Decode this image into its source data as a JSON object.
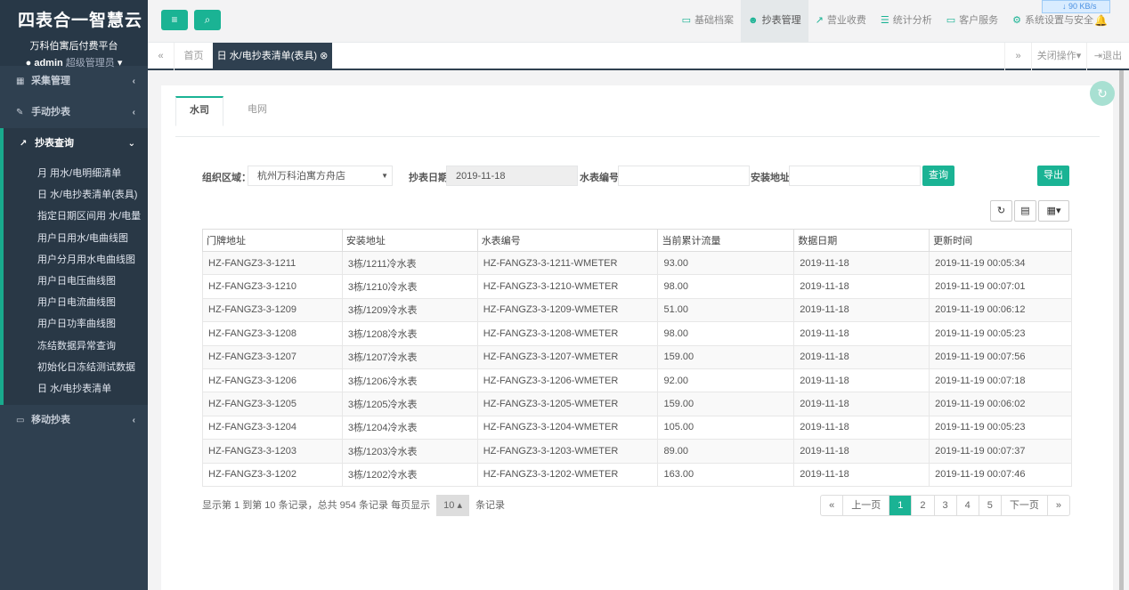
{
  "brand": {
    "title": "四表合一智慧云",
    "subtitle": "万科伯寓后付费平台",
    "user": "admin",
    "role": "超级管理员"
  },
  "sidebar": {
    "items": [
      {
        "label": "采集管理",
        "icon": "calendar-icon"
      },
      {
        "label": "手动抄表",
        "icon": "edit-icon"
      },
      {
        "label": "抄表查询",
        "icon": "chart-icon"
      }
    ],
    "sub": [
      "月 用水/电明细清单",
      "日 水/电抄表清单(表具)",
      "指定日期区间用 水/电量",
      "用户日用水/电曲线图",
      "用户分月用水电曲线图",
      "用户日电压曲线图",
      "用户日电流曲线图",
      "用户日功率曲线图",
      "冻结数据异常查询",
      "初始化日冻结测试数据",
      "日 水/电抄表清单"
    ],
    "last": {
      "label": "移动抄表",
      "icon": "laptop-icon"
    }
  },
  "topnav": [
    "基础档案",
    "抄表管理",
    "营业收费",
    "统计分析",
    "客户服务",
    "系统设置与安全"
  ],
  "speed": "↓ 90 KB/s",
  "tabs": {
    "home": "首页",
    "active": "日 水/电抄表清单(表具)",
    "close_ops": "关闭操作",
    "logout": "退出"
  },
  "content_tabs": [
    "水司",
    "电网"
  ],
  "form": {
    "org_label": "组织区域：",
    "org_value": "杭州万科泊寓方舟店",
    "date_label": "抄表日期",
    "date_value": "2019-11-18",
    "meter_label": "水表编号",
    "addr_label": "安装地址",
    "query": "查询",
    "export": "导出"
  },
  "table": {
    "headers": [
      "门牌地址",
      "安装地址",
      "水表编号",
      "当前累计流量",
      "数据日期",
      "更新时间"
    ],
    "rows": [
      [
        "HZ-FANGZ3-3-1211",
        "3栋/1211冷水表",
        "HZ-FANGZ3-3-1211-WMETER",
        "93.00",
        "2019-11-18",
        "2019-11-19 00:05:34"
      ],
      [
        "HZ-FANGZ3-3-1210",
        "3栋/1210冷水表",
        "HZ-FANGZ3-3-1210-WMETER",
        "98.00",
        "2019-11-18",
        "2019-11-19 00:07:01"
      ],
      [
        "HZ-FANGZ3-3-1209",
        "3栋/1209冷水表",
        "HZ-FANGZ3-3-1209-WMETER",
        "51.00",
        "2019-11-18",
        "2019-11-19 00:06:12"
      ],
      [
        "HZ-FANGZ3-3-1208",
        "3栋/1208冷水表",
        "HZ-FANGZ3-3-1208-WMETER",
        "98.00",
        "2019-11-18",
        "2019-11-19 00:05:23"
      ],
      [
        "HZ-FANGZ3-3-1207",
        "3栋/1207冷水表",
        "HZ-FANGZ3-3-1207-WMETER",
        "159.00",
        "2019-11-18",
        "2019-11-19 00:07:56"
      ],
      [
        "HZ-FANGZ3-3-1206",
        "3栋/1206冷水表",
        "HZ-FANGZ3-3-1206-WMETER",
        "92.00",
        "2019-11-18",
        "2019-11-19 00:07:18"
      ],
      [
        "HZ-FANGZ3-3-1205",
        "3栋/1205冷水表",
        "HZ-FANGZ3-3-1205-WMETER",
        "159.00",
        "2019-11-18",
        "2019-11-19 00:06:02"
      ],
      [
        "HZ-FANGZ3-3-1204",
        "3栋/1204冷水表",
        "HZ-FANGZ3-3-1204-WMETER",
        "105.00",
        "2019-11-18",
        "2019-11-19 00:05:23"
      ],
      [
        "HZ-FANGZ3-3-1203",
        "3栋/1203冷水表",
        "HZ-FANGZ3-3-1203-WMETER",
        "89.00",
        "2019-11-18",
        "2019-11-19 00:07:37"
      ],
      [
        "HZ-FANGZ3-3-1202",
        "3栋/1202冷水表",
        "HZ-FANGZ3-3-1202-WMETER",
        "163.00",
        "2019-11-18",
        "2019-11-19 00:07:46"
      ]
    ]
  },
  "pagination": {
    "info_pre": "显示第 1 到第 10 条记录，总共 954 条记录 每页显示",
    "page_size": "10",
    "info_post": "条记录",
    "pages": [
      "«",
      "上一页",
      "1",
      "2",
      "3",
      "4",
      "5",
      "下一页",
      "»"
    ],
    "current": "1"
  }
}
